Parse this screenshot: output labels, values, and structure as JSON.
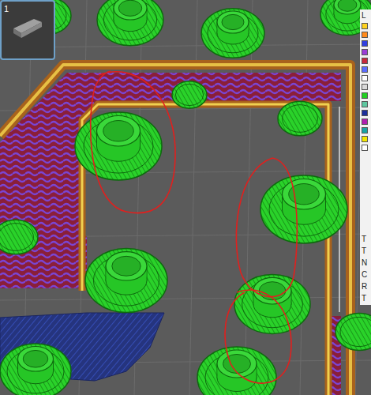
{
  "viewport": {
    "object_label": "1"
  },
  "legend": {
    "title": "L",
    "swatches": [
      {
        "color": "#ffd21f"
      },
      {
        "color": "#ff8a1c"
      },
      {
        "color": "#2f3fe0"
      },
      {
        "color": "#9a3fd6"
      },
      {
        "color": "#c8283c"
      },
      {
        "color": "#5a6cff"
      },
      {
        "color": "#ffffff"
      },
      {
        "color": "#d9d9d9"
      },
      {
        "color": "#1fd01f"
      },
      {
        "color": "#5fc7a0"
      },
      {
        "color": "#1b2f9a"
      },
      {
        "color": "#b01fb0"
      },
      {
        "color": "#19a3a3"
      },
      {
        "color": "#f2e600"
      },
      {
        "color": "#ffffff"
      }
    ],
    "rows": [
      "T",
      "T",
      "N",
      "C",
      "R",
      "T"
    ]
  }
}
